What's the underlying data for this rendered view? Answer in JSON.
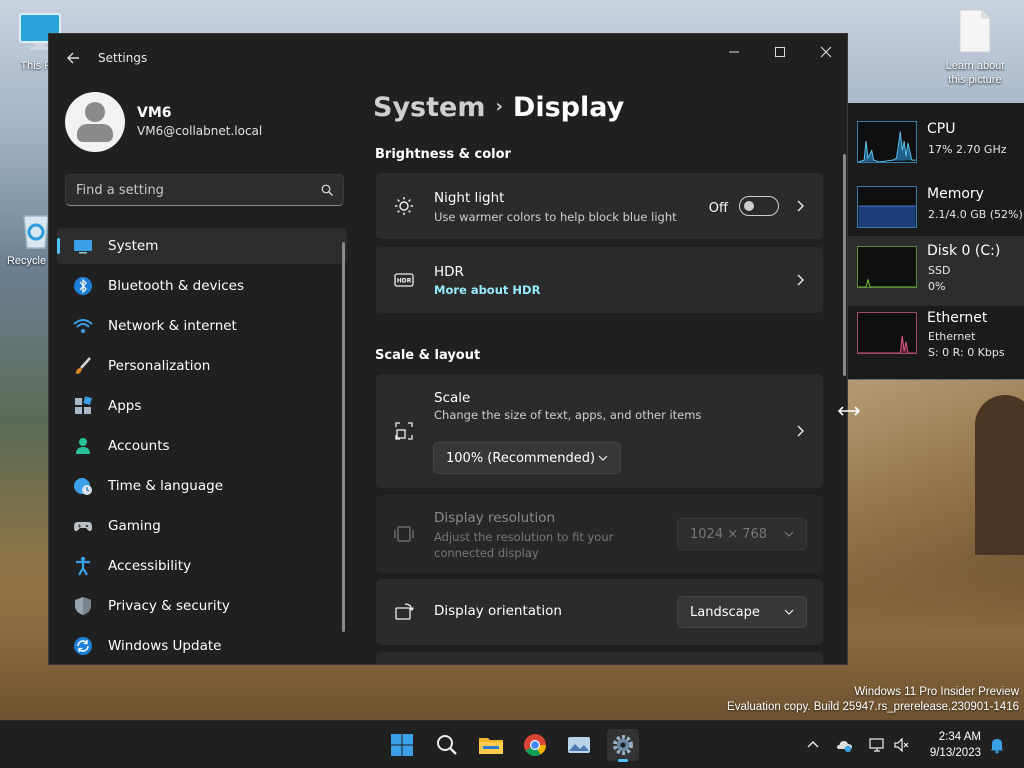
{
  "desktop": {
    "icons": [
      {
        "label": "This PC",
        "icon": "monitor-icon"
      },
      {
        "label": "Recycle Bin",
        "icon": "recycle-bin-icon"
      },
      {
        "label": "Learn about this picture",
        "icon": "document-icon"
      }
    ],
    "watermark": {
      "line1": "Windows 11 Pro Insider Preview",
      "line2": "Evaluation copy. Build 25947.rs_prerelease.230901-1416"
    }
  },
  "window": {
    "title": "Settings",
    "controls": {
      "minimize": "—",
      "maximize": "☐",
      "close": "✕"
    }
  },
  "profile": {
    "name": "VM6",
    "email": "VM6@collabnet.local"
  },
  "search": {
    "placeholder": "Find a setting"
  },
  "nav": {
    "items": [
      {
        "label": "System",
        "icon": "system-icon",
        "active": true
      },
      {
        "label": "Bluetooth & devices",
        "icon": "bluetooth-icon"
      },
      {
        "label": "Network & internet",
        "icon": "network-icon"
      },
      {
        "label": "Personalization",
        "icon": "personalization-icon"
      },
      {
        "label": "Apps",
        "icon": "apps-icon"
      },
      {
        "label": "Accounts",
        "icon": "accounts-icon"
      },
      {
        "label": "Time & language",
        "icon": "time-language-icon"
      },
      {
        "label": "Gaming",
        "icon": "gaming-icon"
      },
      {
        "label": "Accessibility",
        "icon": "accessibility-icon"
      },
      {
        "label": "Privacy & security",
        "icon": "privacy-icon"
      },
      {
        "label": "Windows Update",
        "icon": "windows-update-icon"
      }
    ]
  },
  "breadcrumb": {
    "parent": "System",
    "separator": "›",
    "current": "Display"
  },
  "sections": {
    "brightness": "Brightness & color",
    "scale_layout": "Scale & layout"
  },
  "cards": {
    "night_light": {
      "title": "Night light",
      "desc": "Use warmer colors to help block blue light",
      "state": "Off",
      "on": false
    },
    "hdr": {
      "title": "HDR",
      "link": "More about HDR",
      "icon_text": "HDR"
    },
    "scale": {
      "title": "Scale",
      "desc": "Change the size of text, apps, and other items",
      "value": "100% (Recommended)"
    },
    "resolution": {
      "title": "Display resolution",
      "desc": "Adjust the resolution to fit your connected display",
      "value": "1024 × 768"
    },
    "orientation": {
      "title": "Display orientation",
      "value": "Landscape"
    }
  },
  "perf": {
    "cpu": {
      "name": "CPU",
      "sub1": "17% 2.70 GHz"
    },
    "memory": {
      "name": "Memory",
      "sub1": "2.1/4.0 GB (52%)"
    },
    "disk": {
      "name": "Disk 0 (C:)",
      "sub1": "SSD",
      "sub2": "0%"
    },
    "ethernet": {
      "name": "Ethernet",
      "sub1": "Ethernet",
      "sub2": "S: 0 R: 0 Kbps"
    }
  },
  "taskbar": {
    "clock": {
      "time": "2:34 AM",
      "date": "9/13/2023"
    }
  },
  "colors": {
    "accent": "#4cc2ff",
    "link": "#99ebff",
    "window_bg": "#202020",
    "card_bg": "#2b2b2b"
  }
}
